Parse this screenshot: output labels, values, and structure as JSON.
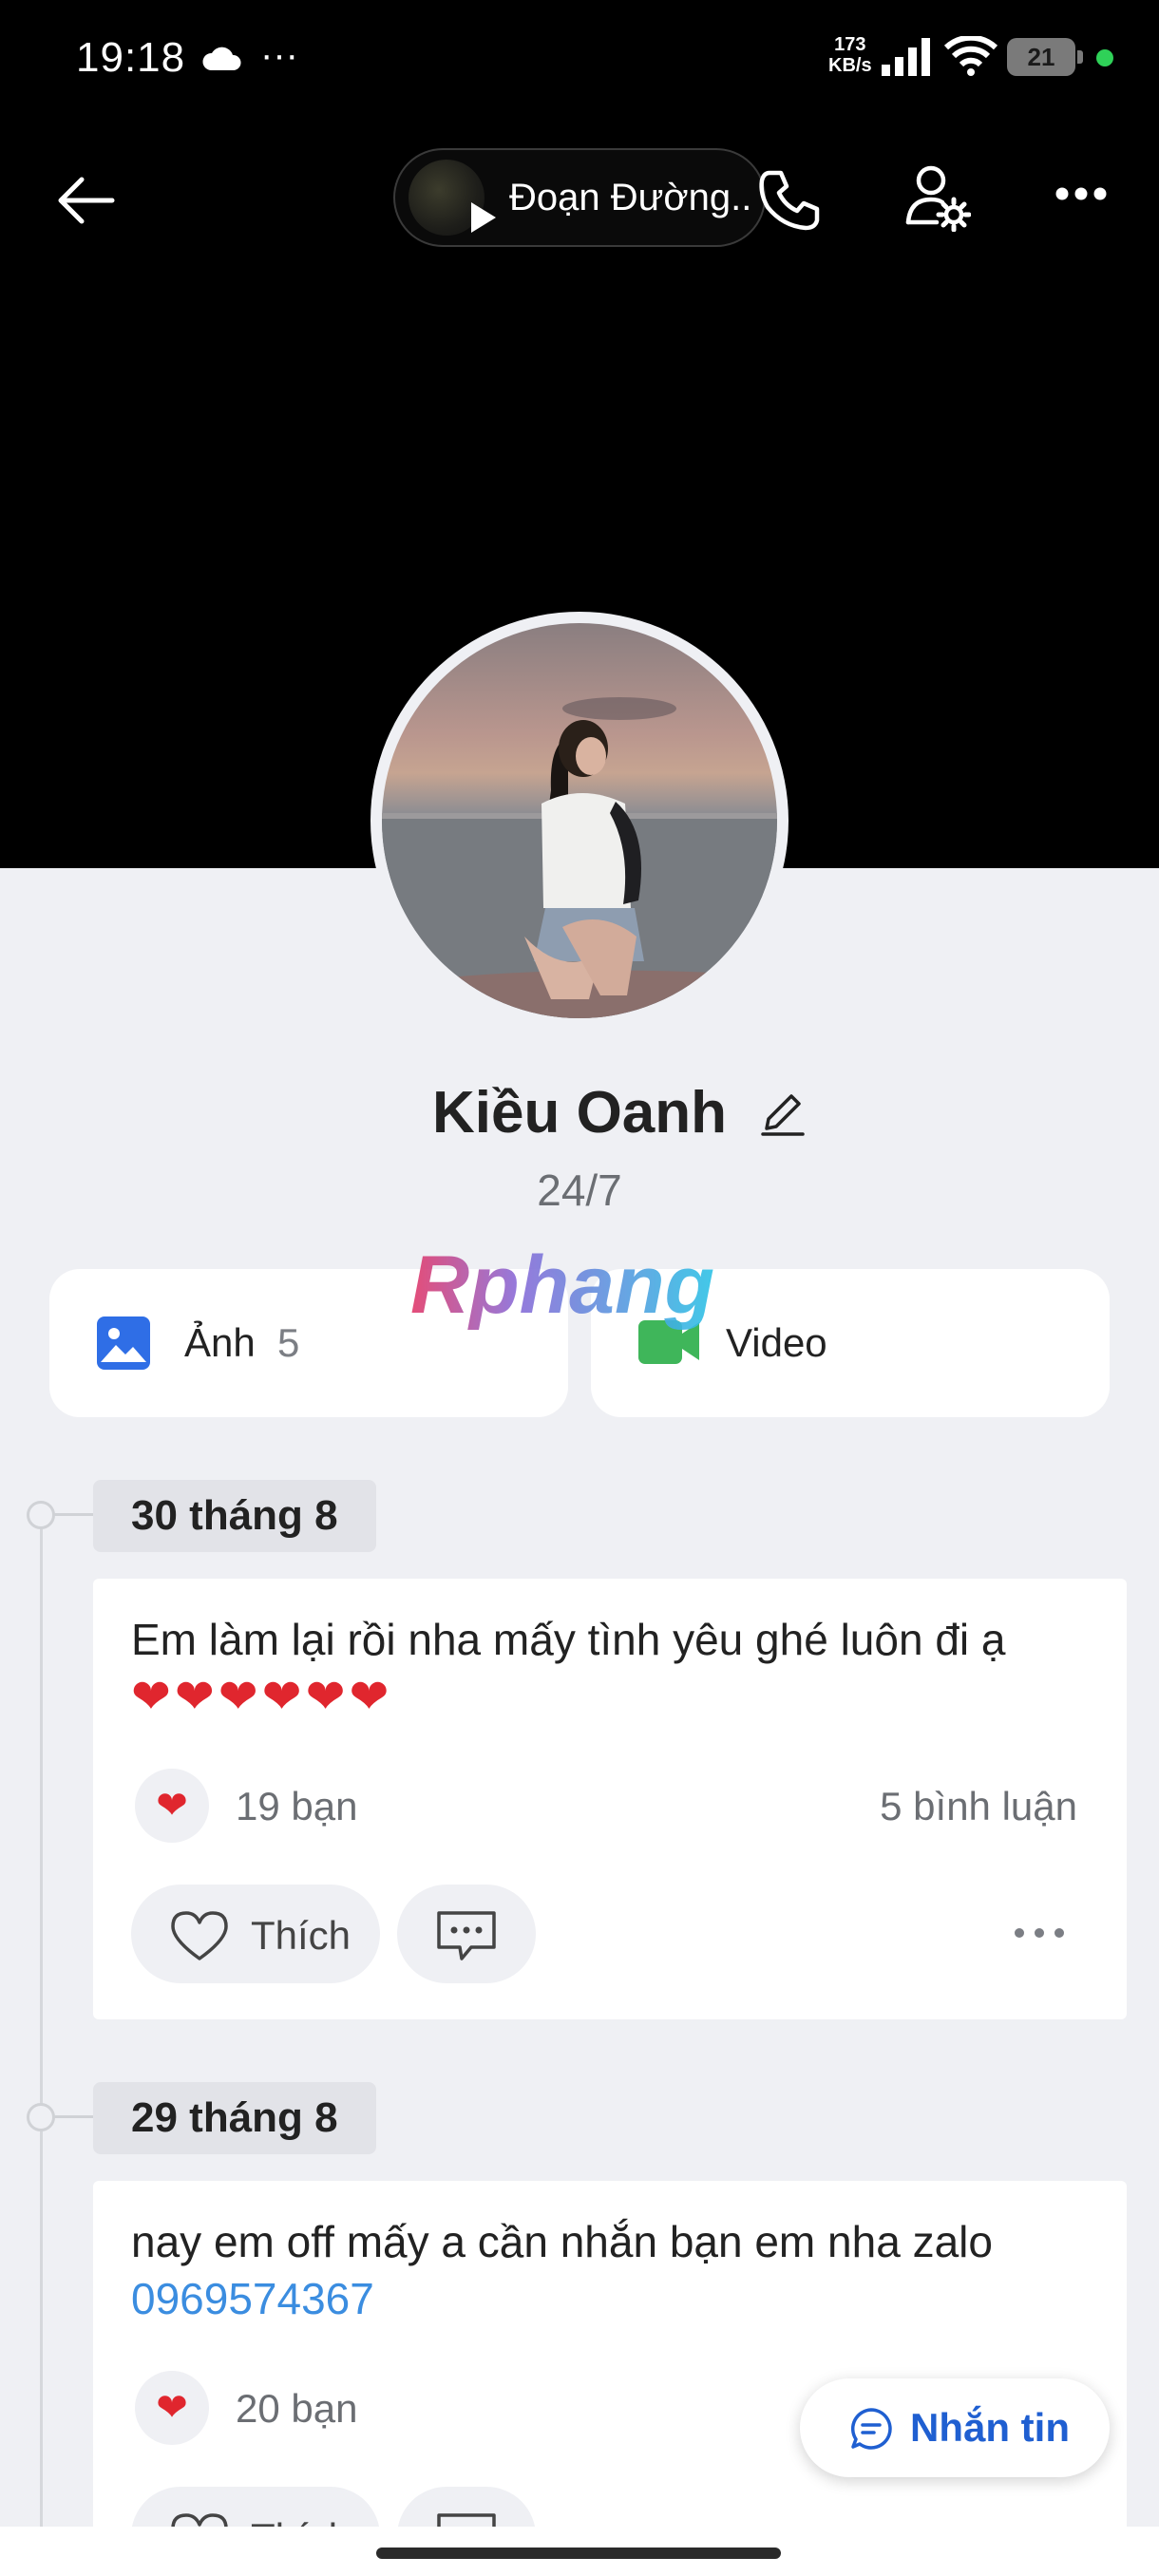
{
  "status_bar": {
    "time": "19:18",
    "more": "···",
    "net_speed_value": "173",
    "net_speed_unit": "KB/s",
    "battery": "21"
  },
  "top_nav": {
    "music_title": "Đoạn Đường.."
  },
  "profile": {
    "name": "Kiều Oanh",
    "status": "24/7",
    "watermark": "Rphang"
  },
  "media": {
    "photos_label": "Ảnh",
    "photos_count": "5",
    "video_label": "Video"
  },
  "posts": [
    {
      "date": "30 tháng 8",
      "text": "Em làm lại rồi nha mấy tình yêu ghé luôn đi ạ",
      "hearts": "❤❤❤❤❤❤",
      "reaction_count": "19 bạn",
      "comment_count": "5 bình luận",
      "like_label": "Thích"
    },
    {
      "date": "29 tháng 8",
      "text": "nay em off mấy a cần nhắn bạn em nha zalo",
      "phone": "0969574367",
      "reaction_count": "20 bạn",
      "like_label": "Thích"
    }
  ],
  "message_button": {
    "label": "Nhắn tin"
  },
  "colors": {
    "accent": "#1f5fd1",
    "heart": "#e0262e",
    "link": "#3b8de0",
    "background": "#eff0f4"
  }
}
